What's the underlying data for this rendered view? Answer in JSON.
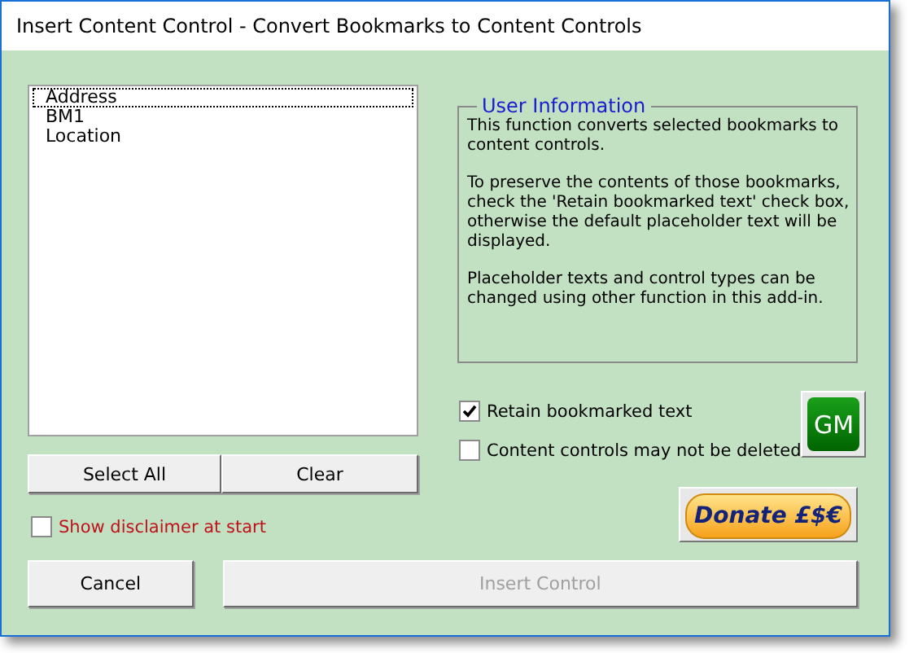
{
  "window": {
    "title": "Insert Content Control - Convert Bookmarks to Content Controls"
  },
  "bookmarks": [
    {
      "label": "Address",
      "focused": true
    },
    {
      "label": "BM1",
      "focused": false
    },
    {
      "label": "Location",
      "focused": false
    }
  ],
  "list_buttons": [
    {
      "label": "Select All"
    },
    {
      "label": "Clear"
    }
  ],
  "disclaimer": {
    "label": "Show disclaimer at start",
    "checked": false
  },
  "info": {
    "title": "User Information",
    "paragraphs": [
      "This function converts selected bookmarks to content controls.",
      "To preserve the contents of those bookmarks, check the 'Retain bookmarked text' check box, otherwise the default placeholder text will be displayed.",
      "Placeholder texts and control types can be changed using other function in this add-in."
    ]
  },
  "options": [
    {
      "label": "Retain bookmarked text",
      "checked": true
    },
    {
      "label": "Content controls may not be deleted",
      "checked": false
    }
  ],
  "logo_button": {
    "label": "GM"
  },
  "donate_button": {
    "label": "Donate £$€"
  },
  "footer_buttons": [
    {
      "label": "Cancel",
      "disabled": false
    },
    {
      "label": "Insert Control",
      "disabled": true
    }
  ]
}
